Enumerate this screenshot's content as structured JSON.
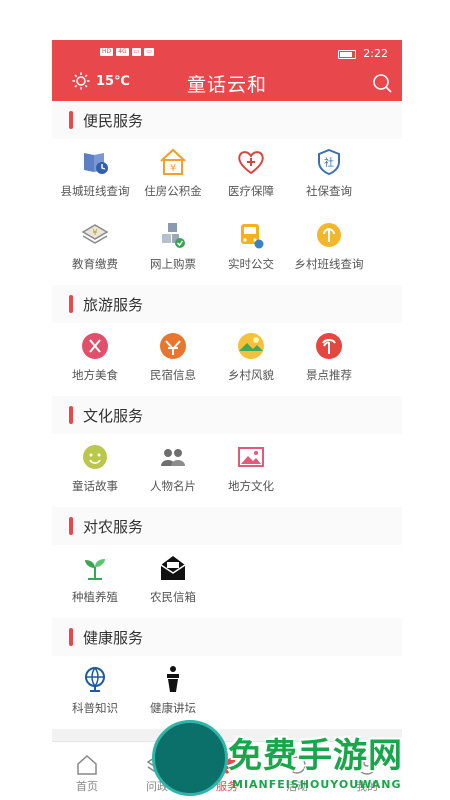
{
  "status_bar": {
    "network_badges": [
      "HD",
      "4G",
      "▭",
      "▭"
    ],
    "time": "2:22"
  },
  "header": {
    "temperature": "15℃",
    "app_title": "童话云和"
  },
  "sections": [
    {
      "title": "便民服务",
      "items": [
        {
          "label": "县城班线查询",
          "icon": "bus-schedule-icon"
        },
        {
          "label": "住房公积金",
          "icon": "housing-fund-icon"
        },
        {
          "label": "医疗保障",
          "icon": "medical-icon"
        },
        {
          "label": "社保查询",
          "icon": "social-security-icon"
        },
        {
          "label": "教育缴费",
          "icon": "education-payment-icon"
        },
        {
          "label": "网上购票",
          "icon": "ticket-icon"
        },
        {
          "label": "实时公交",
          "icon": "bus-icon"
        },
        {
          "label": "乡村班线查询",
          "icon": "village-bus-icon"
        }
      ]
    },
    {
      "title": "旅游服务",
      "items": [
        {
          "label": "地方美食",
          "icon": "food-icon"
        },
        {
          "label": "民宿信息",
          "icon": "homestay-icon"
        },
        {
          "label": "乡村风貌",
          "icon": "landscape-icon"
        },
        {
          "label": "景点推荐",
          "icon": "scenic-spot-icon"
        }
      ]
    },
    {
      "title": "文化服务",
      "items": [
        {
          "label": "童话故事",
          "icon": "fairy-tale-icon"
        },
        {
          "label": "人物名片",
          "icon": "people-icon"
        },
        {
          "label": "地方文化",
          "icon": "picture-icon"
        }
      ]
    },
    {
      "title": "对农服务",
      "items": [
        {
          "label": "种植养殖",
          "icon": "sprout-icon"
        },
        {
          "label": "农民信箱",
          "icon": "mailbox-icon"
        }
      ]
    },
    {
      "title": "健康服务",
      "items": [
        {
          "label": "科普知识",
          "icon": "globe-icon"
        },
        {
          "label": "健康讲坛",
          "icon": "lectern-icon"
        }
      ]
    }
  ],
  "tabbar": [
    {
      "label": "首页",
      "icon": "home-icon"
    },
    {
      "label": "问政",
      "icon": "inquiry-icon"
    },
    {
      "label": "服务",
      "icon": "service-icon",
      "active": true
    },
    {
      "label": "活动",
      "icon": "activity-icon"
    },
    {
      "label": "我的",
      "icon": "profile-icon"
    }
  ],
  "watermark": {
    "title": "免费手游网",
    "subtitle": "MIANFEISHOUYOUWANG"
  },
  "colors": {
    "brand": "#e8474c",
    "watermark": "#19a64a"
  }
}
